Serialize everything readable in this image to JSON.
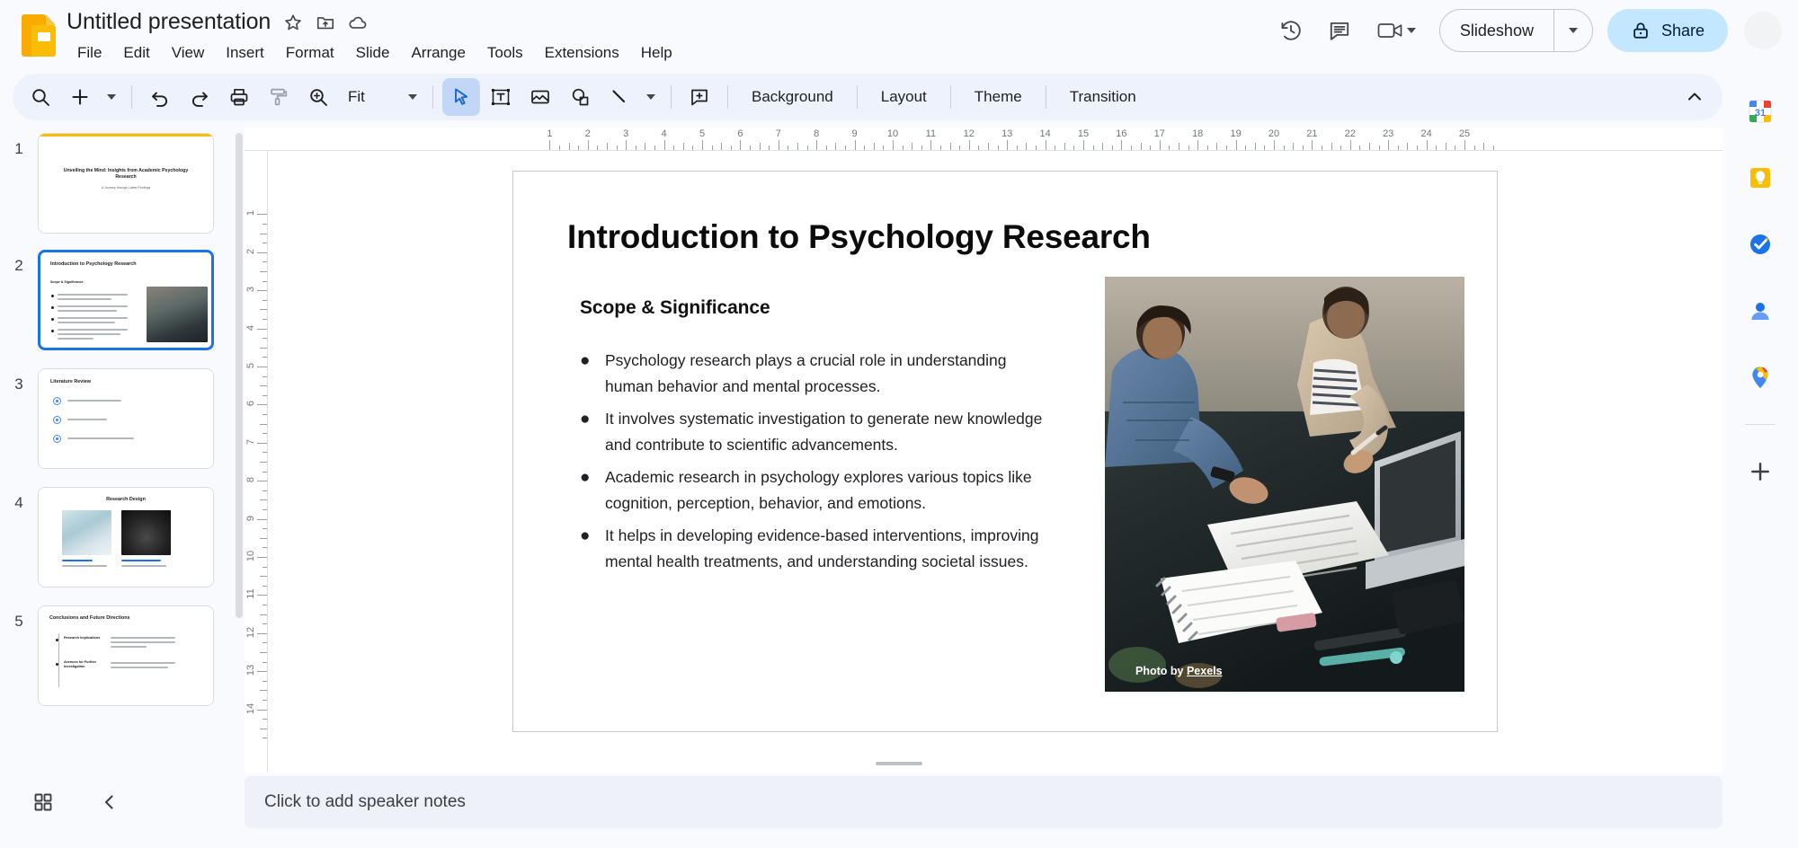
{
  "app": {
    "name": "Google Slides",
    "logo_icon": "slides-logo-icon"
  },
  "header": {
    "doc_title": "Untitled presentation",
    "star_icon": "star-icon",
    "move_icon": "move-to-folder-icon",
    "cloud_icon": "cloud-saved-icon",
    "menus": [
      "File",
      "Edit",
      "View",
      "Insert",
      "Format",
      "Slide",
      "Arrange",
      "Tools",
      "Extensions",
      "Help"
    ],
    "version_history_icon": "version-history-icon",
    "comment_icon": "comment-icon",
    "meet_icon": "video-camera-icon",
    "meet_caret_icon": "chevron-down-icon",
    "slideshow_label": "Slideshow",
    "slideshow_caret_icon": "chevron-down-icon",
    "share_label": "Share",
    "share_lock_icon": "lock-icon",
    "avatar": "user-avatar"
  },
  "toolbar": {
    "search_icon": "search-icon",
    "new_slide_icon": "plus-icon",
    "new_slide_caret_icon": "chevron-down-icon",
    "undo_icon": "undo-icon",
    "redo_icon": "redo-icon",
    "print_icon": "print-icon",
    "paint_format_icon": "paint-format-icon",
    "zoom_icon": "zoom-icon",
    "zoom_level": "Fit",
    "zoom_caret_icon": "chevron-down-icon",
    "select_icon": "cursor-select-icon",
    "textbox_icon": "text-box-icon",
    "image_icon": "insert-image-icon",
    "shape_icon": "insert-shape-icon",
    "line_icon": "insert-line-icon",
    "line_caret_icon": "chevron-down-icon",
    "comment_icon": "add-comment-icon",
    "background_label": "Background",
    "layout_label": "Layout",
    "theme_label": "Theme",
    "transition_label": "Transition",
    "collapse_icon": "chevron-up-icon"
  },
  "filmstrip": {
    "slides": [
      {
        "number": "1",
        "selected": false,
        "title": "Unveiling the Mind: Insights from Academic Psychology Research",
        "subtitle": "A Journey through Latest Findings",
        "layout": "title"
      },
      {
        "number": "2",
        "selected": true,
        "title": "Introduction to Psychology Research",
        "subhead": "Scope & Significance",
        "layout": "text-image"
      },
      {
        "number": "3",
        "selected": false,
        "title": "Literature Review",
        "items": [
          "This slide highlights key theories",
          "It also covers prior studies",
          "Relevant to contemporary psychology research"
        ],
        "layout": "icon-list"
      },
      {
        "number": "4",
        "selected": false,
        "title": "Research Design",
        "captions": [
          "Methodology",
          "Participant Demographics"
        ],
        "layout": "two-image"
      },
      {
        "number": "5",
        "selected": false,
        "title": "Conclusions and Future Directions",
        "items": [
          "Research Implications",
          "Avenues for Further Investigation"
        ],
        "layout": "two-column-list"
      }
    ]
  },
  "slide": {
    "title": "Introduction to Psychology Research",
    "subhead": "Scope & Significance",
    "bullets": [
      "Psychology research plays a crucial role in understanding human behavior and mental processes.",
      "It involves systematic investigation to generate new knowledge and contribute to scientific advancements.",
      "Academic research in psychology explores various topics like cognition, perception, behavior, and emotions.",
      "It helps in developing evidence-based interventions, improving mental health treatments, and understanding societal issues."
    ],
    "photo_credit_prefix": "Photo by ",
    "photo_credit_source": "Pexels",
    "photo_alt": "Two people studying documents at a desk with a laptop"
  },
  "ruler": {
    "horizontal_numbers": [
      "1",
      "2",
      "3",
      "4",
      "5",
      "6",
      "7",
      "8",
      "9",
      "10",
      "11",
      "12",
      "13",
      "14",
      "15",
      "16",
      "17",
      "18",
      "19",
      "20",
      "21",
      "22",
      "23",
      "24",
      "25"
    ],
    "vertical_numbers": [
      "1",
      "2",
      "3",
      "4",
      "5",
      "6",
      "7",
      "8",
      "9",
      "10",
      "11",
      "12",
      "13",
      "14"
    ]
  },
  "notes": {
    "placeholder": "Click to add speaker notes"
  },
  "bottom_bar": {
    "grid_view_icon": "grid-view-icon",
    "collapse_icon": "chevron-left-icon"
  },
  "rail": {
    "items": [
      {
        "icon": "google-calendar-icon",
        "label": "Calendar"
      },
      {
        "icon": "google-keep-icon",
        "label": "Keep"
      },
      {
        "icon": "google-tasks-icon",
        "label": "Tasks"
      },
      {
        "icon": "google-contacts-icon",
        "label": "Contacts"
      },
      {
        "icon": "google-maps-icon",
        "label": "Maps"
      }
    ],
    "add_icon": "plus-icon"
  },
  "colors": {
    "accent_blue": "#1a73e8",
    "share_bg": "#c2e7ff",
    "toolbar_bg": "#edf2fc",
    "page_bg": "#f8fafd",
    "slides_yellow": "#fbbc04"
  }
}
